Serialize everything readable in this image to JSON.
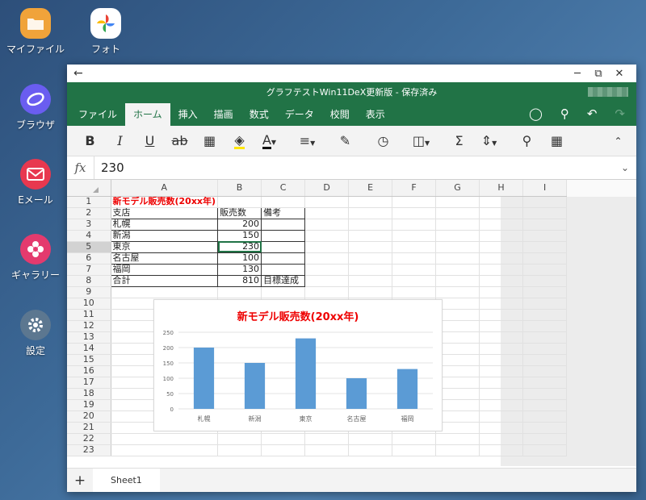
{
  "desktop": [
    {
      "label": "マイファイル",
      "icon": "folder-icon"
    },
    {
      "label": "フォト",
      "icon": "photos-icon"
    },
    {
      "label": "ブラウザ",
      "icon": "browser-icon"
    },
    {
      "label": "Eメール",
      "icon": "email-icon"
    },
    {
      "label": "ギャラリー",
      "icon": "gallery-icon"
    },
    {
      "label": "設定",
      "icon": "settings-icon"
    }
  ],
  "window": {
    "title": "グラフテストWin11DeX更新版 - 保存済み",
    "accent": "#217346"
  },
  "tabs": [
    "ファイル",
    "ホーム",
    "挿入",
    "描画",
    "数式",
    "データ",
    "校閲",
    "表示"
  ],
  "active_tab": "ホーム",
  "toolbar": {
    "bold": "B",
    "italic": "I",
    "underline": "U",
    "strike": "ab",
    "font_color": "A",
    "sum": "Σ"
  },
  "formula": {
    "fx": "fx",
    "value": "230"
  },
  "columns": [
    "A",
    "B",
    "C",
    "D",
    "E",
    "F",
    "G",
    "H",
    "I"
  ],
  "selected_column": "B",
  "selected_row": 5,
  "rows": [
    {
      "n": "1",
      "a": "新モデル販売数(20xx年)",
      "b": "",
      "c": ""
    },
    {
      "n": "2",
      "a": "支店",
      "b": "販売数",
      "c": "備考"
    },
    {
      "n": "3",
      "a": "札幌",
      "b": "200",
      "c": ""
    },
    {
      "n": "4",
      "a": "新潟",
      "b": "150",
      "c": ""
    },
    {
      "n": "5",
      "a": "東京",
      "b": "230",
      "c": ""
    },
    {
      "n": "6",
      "a": "名古屋",
      "b": "100",
      "c": ""
    },
    {
      "n": "7",
      "a": "福岡",
      "b": "130",
      "c": ""
    },
    {
      "n": "8",
      "a": "合計",
      "b": "810",
      "c": "目標達成"
    },
    {
      "n": "9"
    },
    {
      "n": "10"
    },
    {
      "n": "11"
    },
    {
      "n": "12"
    },
    {
      "n": "13"
    },
    {
      "n": "14"
    },
    {
      "n": "15"
    },
    {
      "n": "16"
    },
    {
      "n": "17"
    },
    {
      "n": "18"
    },
    {
      "n": "19"
    },
    {
      "n": "20"
    },
    {
      "n": "21"
    },
    {
      "n": "22"
    },
    {
      "n": "23"
    }
  ],
  "chart_data": {
    "type": "bar",
    "title": "新モデル販売数(20xx年)",
    "categories": [
      "札幌",
      "新潟",
      "東京",
      "名古屋",
      "福岡"
    ],
    "values": [
      200,
      150,
      230,
      100,
      130
    ],
    "yticks": [
      0,
      50,
      100,
      150,
      200,
      250
    ],
    "ylim": [
      0,
      250
    ],
    "bar_color": "#5b9bd5",
    "grid": true
  },
  "sheets": [
    "Sheet1"
  ],
  "add_sheet": "+"
}
